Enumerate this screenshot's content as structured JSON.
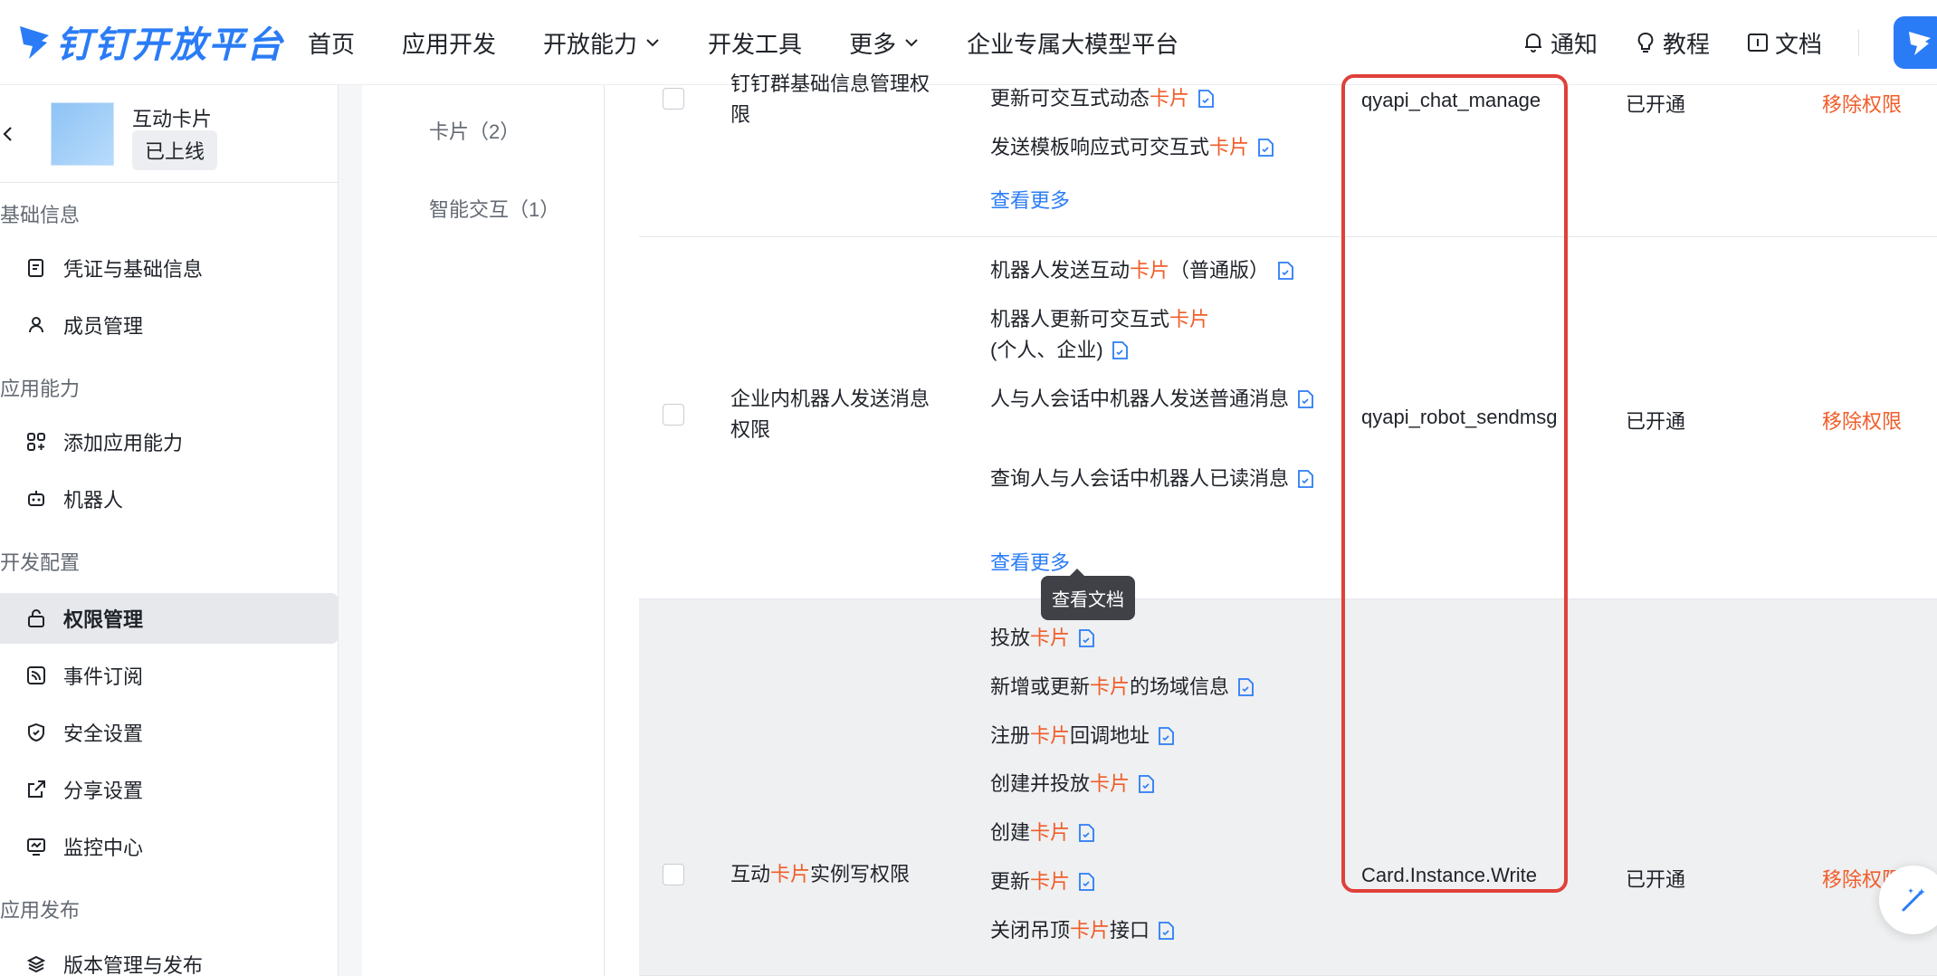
{
  "brand": {
    "name": "钉钉开放平台",
    "color": "#2a7cf6"
  },
  "nav": {
    "items": [
      {
        "label": "首页",
        "has_dropdown": false
      },
      {
        "label": "应用开发",
        "has_dropdown": false
      },
      {
        "label": "开放能力",
        "has_dropdown": true
      },
      {
        "label": "开发工具",
        "has_dropdown": false
      },
      {
        "label": "更多",
        "has_dropdown": true
      },
      {
        "label": "企业专属大模型平台",
        "has_dropdown": false
      }
    ],
    "right": {
      "notify": "通知",
      "tutorial": "教程",
      "docs": "文档"
    }
  },
  "app": {
    "name": "互动卡片",
    "status": "已上线"
  },
  "sidebar": {
    "groups": {
      "basic": "基础信息",
      "capability": "应用能力",
      "dev_config": "开发配置",
      "publish": "应用发布"
    },
    "items": [
      {
        "label": "凭证与基础信息",
        "icon": "credential-icon"
      },
      {
        "label": "成员管理",
        "icon": "member-icon"
      },
      {
        "label": "添加应用能力",
        "icon": "add-capability-icon"
      },
      {
        "label": "机器人",
        "icon": "robot-icon"
      },
      {
        "label": "权限管理",
        "icon": "lock-icon",
        "active": true
      },
      {
        "label": "事件订阅",
        "icon": "rss-icon"
      },
      {
        "label": "安全设置",
        "icon": "shield-icon"
      },
      {
        "label": "分享设置",
        "icon": "share-icon"
      },
      {
        "label": "监控中心",
        "icon": "monitor-icon"
      },
      {
        "label": "版本管理与发布",
        "icon": "layers-icon"
      }
    ]
  },
  "categories": [
    "卡片（2）",
    "智能交互（1）"
  ],
  "table": {
    "rows": [
      {
        "perm_name_parts": [
          "钉钉群基础信息管理权",
          "限"
        ],
        "apis": [
          {
            "pre": "更新可交互式动态",
            "hit": "卡片",
            "post": ""
          },
          {
            "pre": "发送模板响应式可交互式",
            "hit": "卡片",
            "post": ""
          }
        ],
        "more": "查看更多",
        "code": "qyapi_chat_manage",
        "status": "已开通",
        "action": "移除权限"
      },
      {
        "perm_name_parts": [
          "企业内机器人发送消息",
          "权限"
        ],
        "apis": [
          {
            "pre": "机器人发送互动",
            "hit": "卡片",
            "post": "（普通版）"
          },
          {
            "pre": "机器人更新可交互式",
            "hit": "卡片",
            "post": "(个人、企业)"
          },
          {
            "pre": "人与人会话中机器人发送普通消息",
            "hit": "",
            "post": ""
          },
          {
            "pre": "查询人与人会话中机器人已读消息",
            "hit": "",
            "post": ""
          }
        ],
        "more": "查看更多",
        "code": "qyapi_robot_sendmsg",
        "status": "已开通",
        "action": "移除权限"
      },
      {
        "perm_name_parts": [
          "互动",
          "卡片",
          "实例写权限"
        ],
        "apis": [
          {
            "pre": "投放",
            "hit": "卡片",
            "post": ""
          },
          {
            "pre": "新增或更新",
            "hit": "卡片",
            "post": "的场域信息"
          },
          {
            "pre": "注册",
            "hit": "卡片",
            "post": "回调地址"
          },
          {
            "pre": "创建并投放",
            "hit": "卡片",
            "post": ""
          },
          {
            "pre": "创建",
            "hit": "卡片",
            "post": ""
          },
          {
            "pre": "更新",
            "hit": "卡片",
            "post": ""
          },
          {
            "pre": "关闭吊顶",
            "hit": "卡片",
            "post": "接口"
          }
        ],
        "code": "Card.Instance.Write",
        "status": "已开通",
        "action": "移除权限"
      }
    ]
  },
  "tooltip": "查看文档",
  "colors": {
    "accent": "#2a7cf6",
    "highlight": "#f05d2a",
    "annotation": "#e0403a"
  }
}
